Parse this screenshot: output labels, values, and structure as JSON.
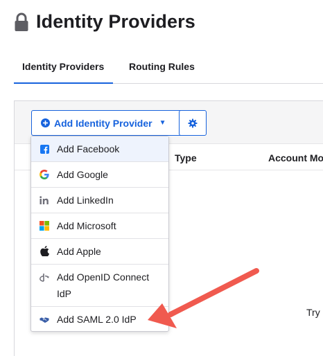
{
  "page": {
    "title": "Identity Providers",
    "icon": "lock-icon"
  },
  "tabs": [
    {
      "label": "Identity Providers",
      "active": true
    },
    {
      "label": "Routing Rules",
      "active": false
    }
  ],
  "toolbar": {
    "add_button_label": "Add Identity Provider",
    "add_button_caret": "▼",
    "settings_icon": "gear-icon",
    "accent_color": "#1662dd"
  },
  "table": {
    "columns": [
      "Type",
      "Account Mo"
    ],
    "empty_text": "Try s"
  },
  "dropdown": {
    "items": [
      {
        "label": "Add Facebook",
        "icon": "facebook-icon"
      },
      {
        "label": "Add Google",
        "icon": "google-icon"
      },
      {
        "label": "Add LinkedIn",
        "icon": "linkedin-icon"
      },
      {
        "label": "Add Microsoft",
        "icon": "microsoft-icon"
      },
      {
        "label": "Add Apple",
        "icon": "apple-icon"
      },
      {
        "label": "Add OpenID Connect",
        "label_line2": "IdP",
        "icon": "openid-icon"
      },
      {
        "label": "Add SAML 2.0 IdP",
        "icon": "saml-handshake-icon"
      }
    ]
  },
  "annotation": {
    "arrow_color": "#f05a4f"
  }
}
